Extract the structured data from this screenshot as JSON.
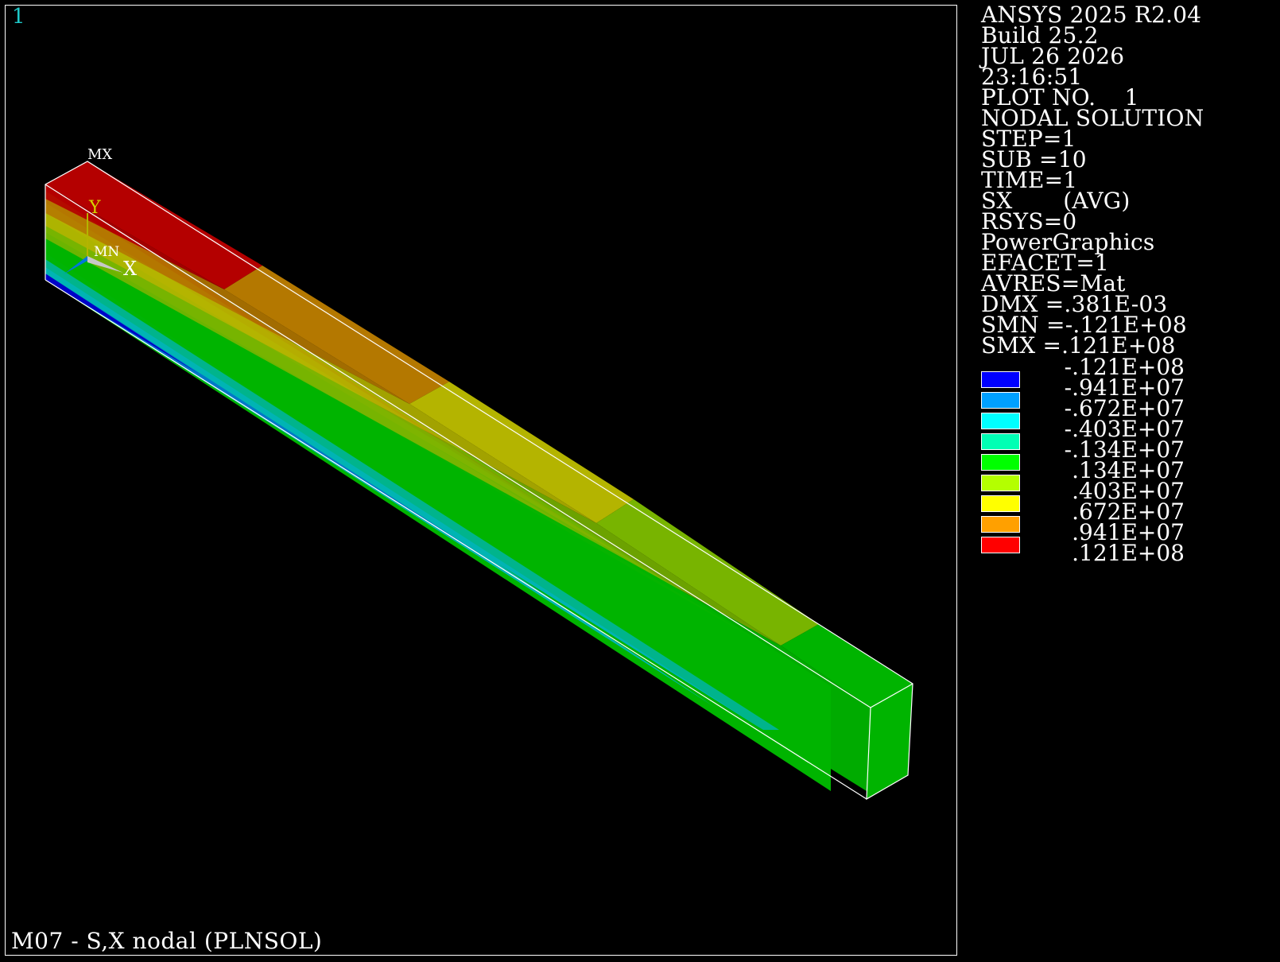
{
  "window": {
    "number": "1"
  },
  "footer": {
    "caption": "M07 - S,X nodal (PLNSOL)"
  },
  "info": {
    "lines": [
      "ANSYS 2025 R2.04",
      "Build 25.2",
      "JUL 26 2026",
      "23:16:51",
      "PLOT NO.    1",
      "NODAL SOLUTION",
      "STEP=1",
      "SUB =10",
      "TIME=1",
      "SX       (AVG)",
      "RSYS=0",
      "PowerGraphics",
      "EFACET=1",
      "AVRES=Mat",
      "DMX =.381E-03",
      "SMN =-.121E+08",
      "SMX =.121E+08"
    ]
  },
  "legend": {
    "values": [
      "-.121E+08",
      "-.941E+07",
      "-.672E+07",
      "-.403E+07",
      "-.134E+07",
      ".134E+07",
      ".403E+07",
      ".672E+07",
      ".941E+07",
      ".121E+08"
    ],
    "colors": [
      "#0000ff",
      "#00a0ff",
      "#00ffff",
      "#00ffb4",
      "#00ff00",
      "#b4ff00",
      "#ffff00",
      "#ffa000",
      "#ff0000"
    ]
  },
  "markers": {
    "max": "MX",
    "min": "MN"
  },
  "triad": {
    "x": "X",
    "y": "Y"
  }
}
